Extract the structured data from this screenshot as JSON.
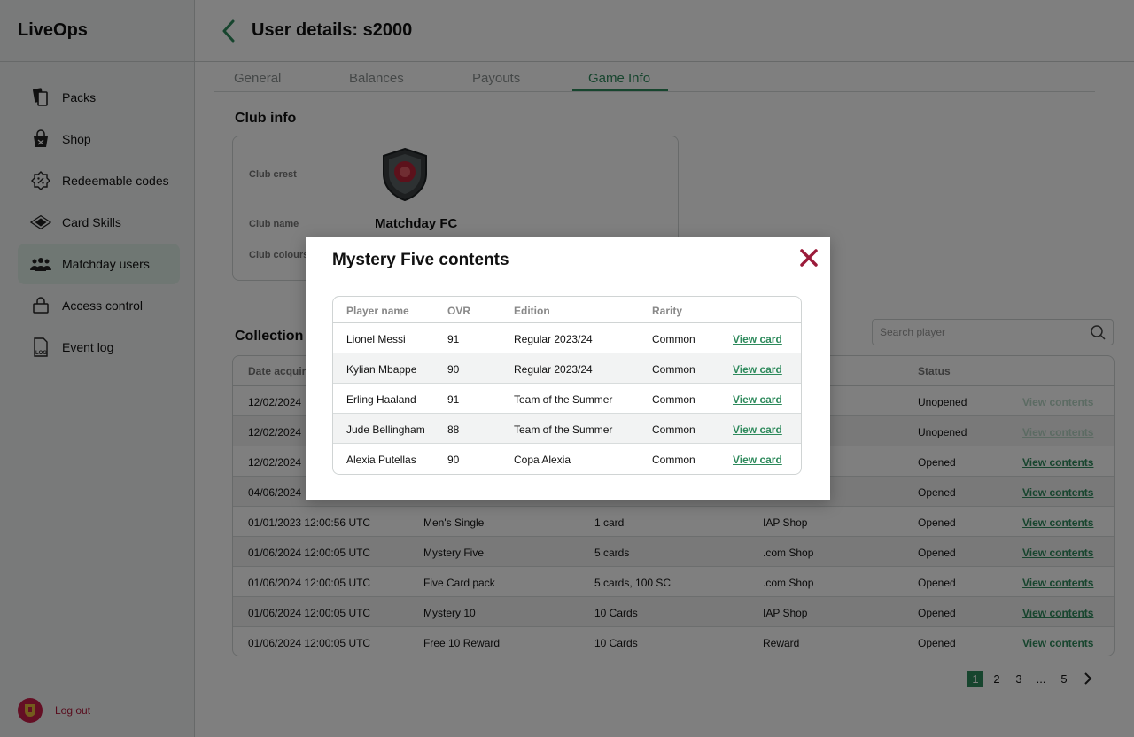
{
  "app": {
    "brand": "LiveOps"
  },
  "sidebar": {
    "items": [
      {
        "label": "Packs",
        "icon": "cards-icon"
      },
      {
        "label": "Shop",
        "icon": "shopping-bag-icon"
      },
      {
        "label": "Redeemable codes",
        "icon": "discount-badge-icon"
      },
      {
        "label": "Card Skills",
        "icon": "diamond-icon"
      },
      {
        "label": "Matchday users",
        "icon": "users-icon",
        "active": true
      },
      {
        "label": "Access control",
        "icon": "lock-icon"
      },
      {
        "label": "Event log",
        "icon": "log-file-icon"
      }
    ],
    "logout_label": "Log out"
  },
  "header": {
    "title": "User details: s2000"
  },
  "tabs": [
    {
      "label": "General"
    },
    {
      "label": "Balances"
    },
    {
      "label": "Payouts"
    },
    {
      "label": "Game Info",
      "active": true
    }
  ],
  "club_info": {
    "title": "Club info",
    "crest_label": "Club crest",
    "name_label": "Club name",
    "name_value": "Matchday FC",
    "colours_label": "Club colours"
  },
  "collection": {
    "title": "Collection",
    "search_placeholder": "Search player",
    "headers": {
      "date": "Date acquired",
      "status": "Status"
    },
    "rows": [
      {
        "date": "12/02/2024",
        "pack": "",
        "contents": "",
        "source": "",
        "status": "Unopened",
        "action": "View contents",
        "enabled": false
      },
      {
        "date": "12/02/2024",
        "pack": "",
        "contents": "",
        "source": "",
        "status": "Unopened",
        "action": "View contents",
        "enabled": false
      },
      {
        "date": "12/02/2024",
        "pack": "",
        "contents": "",
        "source": "",
        "status": "Opened",
        "action": "View contents",
        "enabled": true
      },
      {
        "date": "04/06/2024",
        "pack": "",
        "contents": "",
        "source": "",
        "status": "Opened",
        "action": "View contents",
        "enabled": true
      },
      {
        "date": "01/01/2023 12:00:56 UTC",
        "pack": "Men's Single",
        "contents": "1 card",
        "source": "IAP Shop",
        "status": "Opened",
        "action": "View contents",
        "enabled": true
      },
      {
        "date": "01/06/2024 12:00:05 UTC",
        "pack": "Mystery Five",
        "contents": "5 cards",
        "source": ".com Shop",
        "status": "Opened",
        "action": "View contents",
        "enabled": true
      },
      {
        "date": "01/06/2024 12:00:05 UTC",
        "pack": "Five Card pack",
        "contents": "5 cards, 100 SC",
        "source": ".com Shop",
        "status": "Opened",
        "action": "View contents",
        "enabled": true
      },
      {
        "date": "01/06/2024 12:00:05 UTC",
        "pack": "Mystery 10",
        "contents": "10 Cards",
        "source": "IAP Shop",
        "status": "Opened",
        "action": "View contents",
        "enabled": true
      },
      {
        "date": "01/06/2024 12:00:05 UTC",
        "pack": "Free 10 Reward",
        "contents": "10 Cards",
        "source": "Reward",
        "status": "Opened",
        "action": "View contents",
        "enabled": true
      }
    ]
  },
  "pagination": {
    "pages": [
      "1",
      "2",
      "3",
      "...",
      "5"
    ],
    "current": "1"
  },
  "modal": {
    "title": "Mystery Five contents",
    "headers": {
      "player": "Player name",
      "ovr": "OVR",
      "edition": "Edition",
      "rarity": "Rarity"
    },
    "rows": [
      {
        "player": "Lionel Messi",
        "ovr": "91",
        "edition": "Regular 2023/24",
        "rarity": "Common",
        "action": "View card"
      },
      {
        "player": "Kylian Mbappe",
        "ovr": "90",
        "edition": "Regular 2023/24",
        "rarity": "Common",
        "action": "View card"
      },
      {
        "player": "Erling Haaland",
        "ovr": "91",
        "edition": "Team of the Summer",
        "rarity": "Common",
        "action": "View card"
      },
      {
        "player": "Jude Bellingham",
        "ovr": "88",
        "edition": "Team of the Summer",
        "rarity": "Common",
        "action": "View card"
      },
      {
        "player": "Alexia Putellas",
        "ovr": "90",
        "edition": "Copa Alexia",
        "rarity": "Common",
        "action": "View card"
      }
    ]
  },
  "colors": {
    "accent": "#2e8a5c",
    "danger": "#9b1b3a",
    "active_nav": "#dfeee6"
  }
}
